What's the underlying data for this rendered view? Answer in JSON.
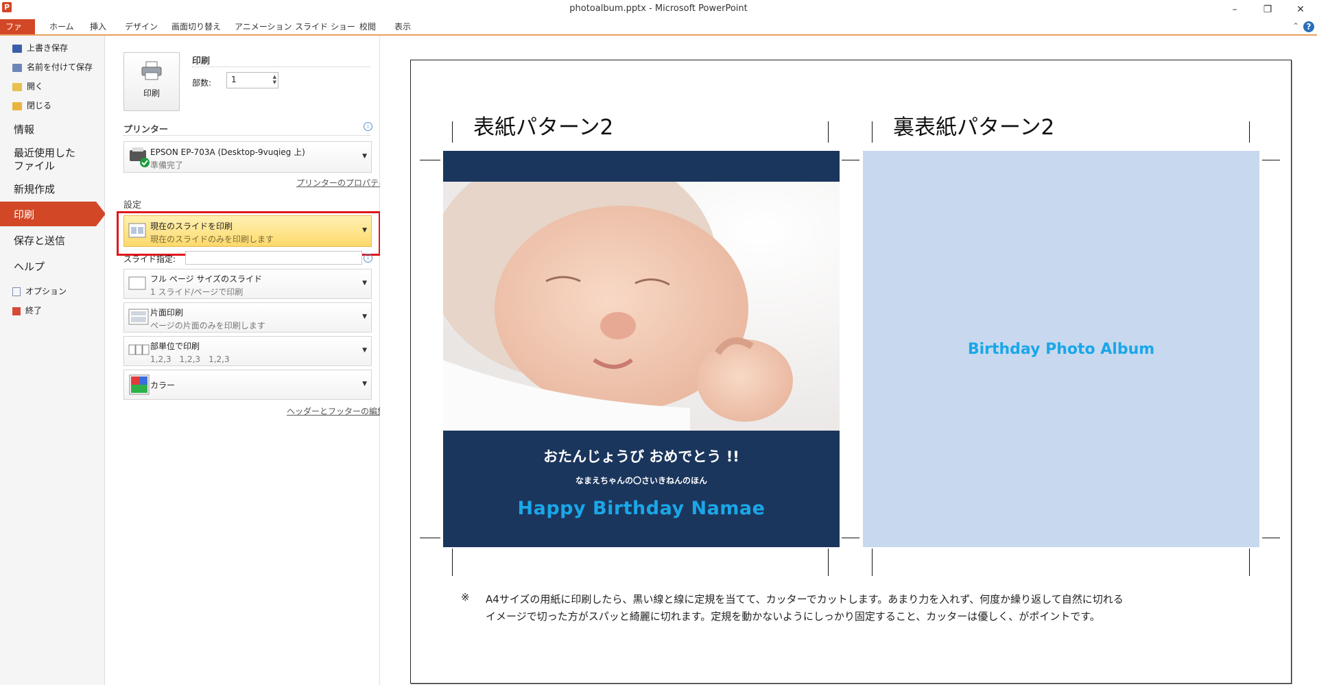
{
  "window": {
    "title": "photoalbum.pptx - Microsoft PowerPoint",
    "app_icon": "P",
    "controls": [
      "minimize",
      "restore",
      "close"
    ]
  },
  "ribbon": {
    "tabs": [
      "ファイル",
      "ホーム",
      "挿入",
      "デザイン",
      "画面切り替え",
      "アニメーション",
      "スライド ショー",
      "校閲",
      "表示"
    ],
    "help": "?"
  },
  "nav": {
    "save": "上書き保存",
    "save_as": "名前を付けて保存",
    "open": "開く",
    "close": "閉じる",
    "info": "情報",
    "recent_line1": "最近使用した",
    "recent_line2": "ファイル",
    "new": "新規作成",
    "print": "印刷",
    "save_send": "保存と送信",
    "help": "ヘルプ",
    "options": "オプション",
    "exit": "終了"
  },
  "print": {
    "section_title": "印刷",
    "button_label": "印刷",
    "copies_label": "部数:",
    "copies_value": "1"
  },
  "printer": {
    "section_title": "プリンター",
    "name": "EPSON EP-703A (Desktop-9vuqieg 上)",
    "status": "準備完了",
    "properties_link": "プリンターのプロパティ"
  },
  "settings": {
    "section_title": "設定",
    "range_title": "現在のスライドを印刷",
    "range_desc": "現在のスライドのみを印刷します",
    "slides_label": "スライド指定:",
    "slides_value": "",
    "layout_title": "フル ページ サイズのスライド",
    "layout_desc": "1 スライド/ページで印刷",
    "sides_title": "片面印刷",
    "sides_desc": "ページの片面のみを印刷します",
    "collate_title": "部単位で印刷",
    "collate_desc": "1,2,3　1,2,3　1,2,3",
    "color_title": "カラー",
    "header_footer_link": "ヘッダーとフッターの編集"
  },
  "slide": {
    "front_heading": "表紙パターン2",
    "back_heading": "裏表紙パターン2",
    "front_title": "おたんじょうび おめでとう !!",
    "front_subtitle": "なまえちゃんの〇さいきねんのほん",
    "front_english": "Happy Birthday Namae",
    "back_title": "Birthday Photo Album",
    "note_mark": "※",
    "note_line1": "A4サイズの用紙に印刷したら、黒い線と線に定規を当てて、カッターでカットします。あまり力を入れず、何度か繰り返して自然に切れる",
    "note_line2": "イメージで切った方がスパッと綺麗に切れます。定規を動かないようにしっかり固定すること、カッターは優しく、がポイントです。",
    "colors": {
      "navy": "#1b365d",
      "light_blue": "#c7d8ef",
      "accent": "#1aa7e8",
      "file_tab": "#d24726"
    }
  }
}
